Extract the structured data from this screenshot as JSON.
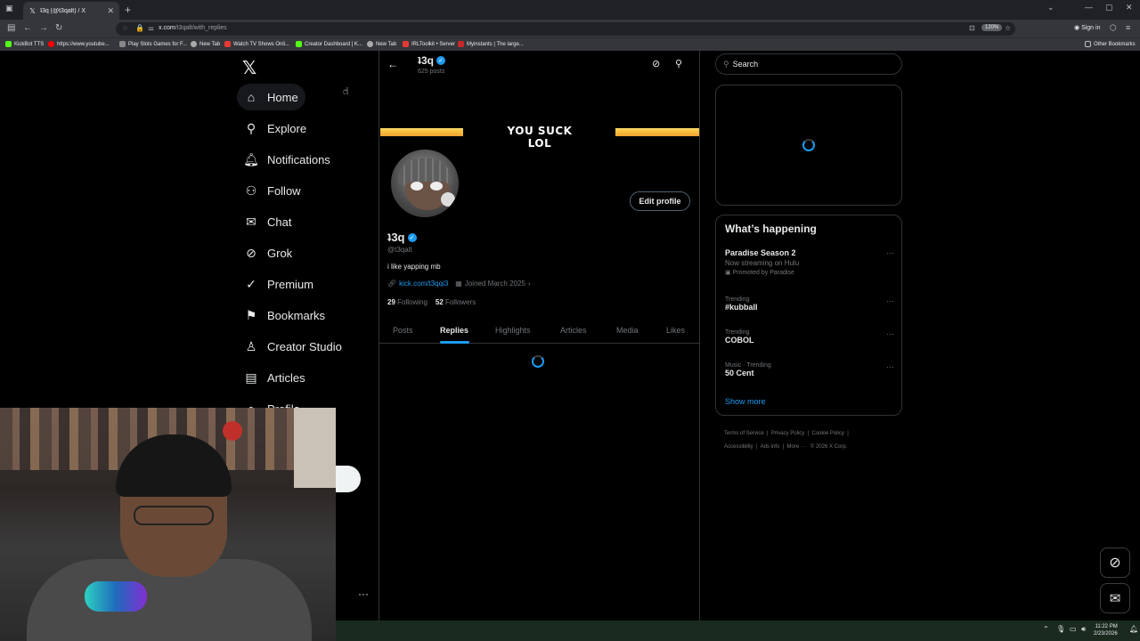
{
  "browser": {
    "tab_title": "ʇ3q (@t3qalt) / X",
    "url_host": "x.com",
    "url_path": "/t3qalt/with_replies",
    "zoom": "120%",
    "sign_in": "Sign in",
    "bookmarks": [
      "KickBot TTS",
      "https://www.youtube...",
      "Play Slots Games for F...",
      "New Tab",
      "Watch TV Shows Onli...",
      "Creator Dashboard | K...",
      "New Tab",
      "IRLToolkit • Server",
      "Myinstants | The large..."
    ],
    "other_bookmarks": "Other Bookmarks"
  },
  "nav": {
    "items": [
      {
        "label": "Home",
        "icon": "home-icon"
      },
      {
        "label": "Explore",
        "icon": "search-icon"
      },
      {
        "label": "Notifications",
        "icon": "bell-icon"
      },
      {
        "label": "Follow",
        "icon": "person-plus-icon"
      },
      {
        "label": "Chat",
        "icon": "mail-icon"
      },
      {
        "label": "Grok",
        "icon": "grok-icon"
      },
      {
        "label": "Premium",
        "icon": "check-badge-icon"
      },
      {
        "label": "Bookmarks",
        "icon": "bookmark-icon"
      },
      {
        "label": "Creator Studio",
        "icon": "creator-icon"
      },
      {
        "label": "Articles",
        "icon": "articles-icon"
      },
      {
        "label": "Profile",
        "icon": "profile-icon"
      }
    ]
  },
  "profile": {
    "top_name": "ʇ3q",
    "post_count": "625 posts",
    "banner_text": "YOU SUCK LOL",
    "edit_label": "Edit profile",
    "name": "ʇ3q",
    "handle": "@t3qalt",
    "bio": "i like yapping mb",
    "link": "kick.com/t3qqi3",
    "joined": "Joined March 2025",
    "following_count": "29",
    "following_label": "Following",
    "followers_count": "52",
    "followers_label": "Followers",
    "tabs": [
      "Posts",
      "Replies",
      "Highlights",
      "Articles",
      "Media",
      "Likes"
    ],
    "active_tab": "Replies"
  },
  "sidebar": {
    "search_placeholder": "Search",
    "whats_happening": "What’s happening",
    "trends": [
      {
        "context": "",
        "title": "Paradise Season 2",
        "sub": "Now streaming on Hulu",
        "promo": "Promoted by Paradise"
      },
      {
        "context": "Trending",
        "title": "#kubball",
        "sub": "",
        "promo": ""
      },
      {
        "context": "Trending",
        "title": "COBOL",
        "sub": "",
        "promo": ""
      },
      {
        "context": "Music · Trending",
        "title": "50 Cent",
        "sub": "",
        "promo": ""
      }
    ],
    "show_more": "Show more",
    "footer": [
      "Terms of Service",
      "Privacy Policy",
      "Cookie Policy",
      "Accessibility",
      "Ads info",
      "More ···",
      "© 2026 X Corp."
    ]
  },
  "system": {
    "time": "11:22 PM",
    "date": "2/23/2026"
  },
  "colors": {
    "accent": "#1d9bf0",
    "background": "#000000",
    "border": "#2f3336",
    "muted": "#71767b"
  }
}
